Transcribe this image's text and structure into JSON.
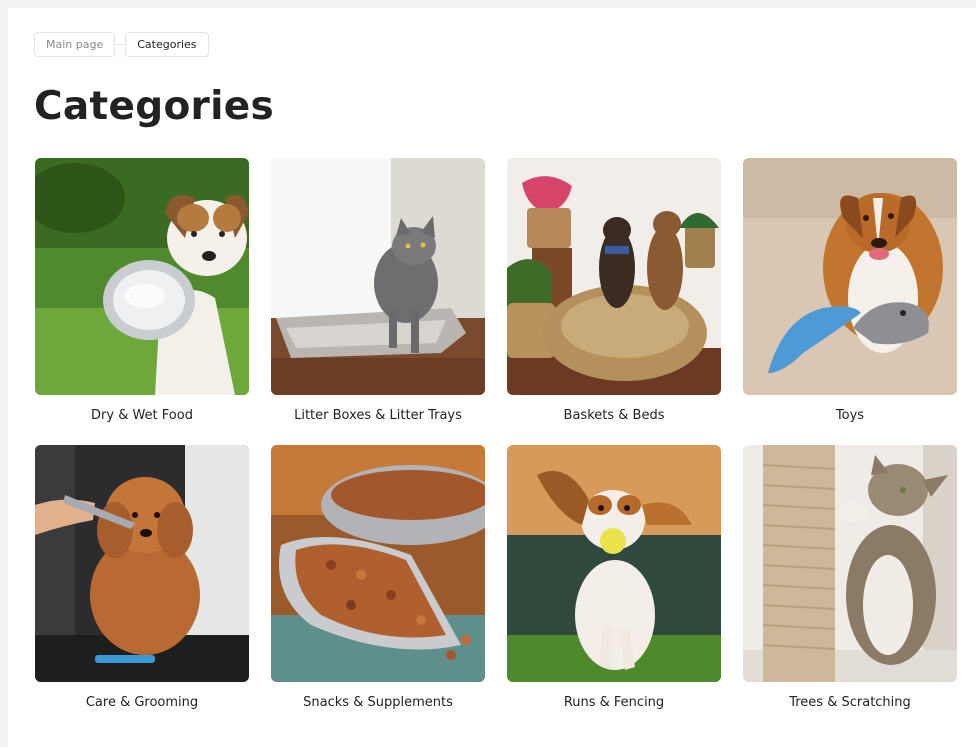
{
  "breadcrumb": {
    "home_label": "Main page",
    "current_label": "Categories"
  },
  "page": {
    "title": "Categories"
  },
  "categories": [
    {
      "label": "Dry & Wet Food",
      "image": "puppy-with-food-bowl"
    },
    {
      "label": "Litter Boxes & Litter Trays",
      "image": "cat-in-litter-tray"
    },
    {
      "label": "Baskets & Beds",
      "image": "dogs-in-wicker-basket"
    },
    {
      "label": "Toys",
      "image": "dog-with-plush-toys"
    },
    {
      "label": "Care & Grooming",
      "image": "poodle-being-groomed"
    },
    {
      "label": "Snacks & Supplements",
      "image": "kibble-scoop"
    },
    {
      "label": "Runs & Fencing",
      "image": "beagle-running-with-ball"
    },
    {
      "label": "Trees & Scratching",
      "image": "cat-on-scratching-post"
    }
  ],
  "colors": {
    "border": "#e3e3e3",
    "muted_text": "#8a8a8a",
    "text": "#222222",
    "background": "#ffffff"
  }
}
